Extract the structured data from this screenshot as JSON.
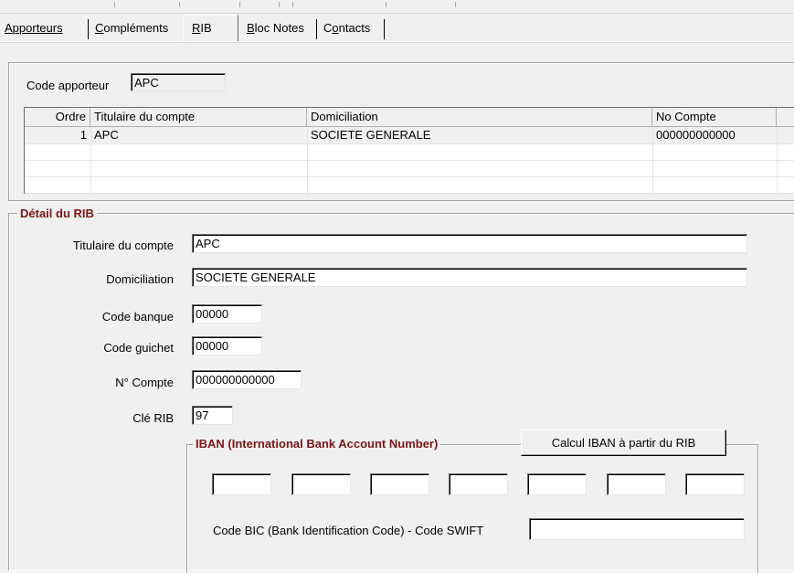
{
  "tabs": [
    {
      "label": "Apporteurs",
      "accel": "A"
    },
    {
      "label": "Compléments",
      "accel": "C"
    },
    {
      "label": "RIB",
      "accel": "R"
    },
    {
      "label": "Bloc Notes",
      "accel": "B"
    },
    {
      "label": "Contacts",
      "accel": "o"
    }
  ],
  "header": {
    "code_label": "Code apporteur",
    "code_value": "APC"
  },
  "grid": {
    "columns": [
      "Ordre",
      "Titulaire du compte",
      "Domiciliation",
      "No Compte",
      ""
    ],
    "rows": [
      {
        "ordre": "1",
        "titulaire": "APC",
        "domiciliation": "SOCIETE GENERALE",
        "no_compte": "000000000000"
      }
    ]
  },
  "detail": {
    "title": "Détail du RIB",
    "titulaire_label": "Titulaire du compte",
    "titulaire_value": "APC",
    "domiciliation_label": "Domiciliation",
    "domiciliation_value": "SOCIETE GENERALE",
    "code_banque_label": "Code banque",
    "code_banque_value": "00000",
    "code_guichet_label": "Code guichet",
    "code_guichet_value": "00000",
    "compte_label": "N° Compte",
    "compte_value": "000000000000",
    "cle_label": "Clé RIB",
    "cle_value": "97"
  },
  "iban": {
    "title": "IBAN (International Bank Account Number)",
    "calc_button": "Calcul IBAN à partir du RIB",
    "segments": [
      "",
      "",
      "",
      "",
      "",
      "",
      ""
    ],
    "bic_label": "Code BIC (Bank Identification Code) - Code SWIFT",
    "bic_value": ""
  },
  "colors": {
    "legend": "#7a1616",
    "background": "#f0f0f0"
  }
}
